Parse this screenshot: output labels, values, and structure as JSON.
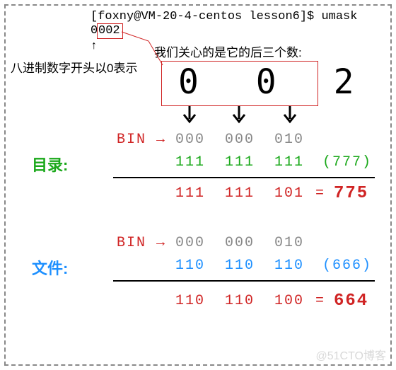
{
  "terminal": {
    "prompt": "[foxny@VM-20-4-centos lesson6]$ umask",
    "output_prefix": "0",
    "output_suffix": "002"
  },
  "notes": {
    "up_arrow": "↑",
    "octal_tip": "八进制数字开头以0表示",
    "focus_tip": "我们关心的是它的后三个数:"
  },
  "big_digits": "0 0 2",
  "bin_label": "BIN →",
  "bin1": {
    "a": "000",
    "b": "000",
    "c": "010"
  },
  "bin2": {
    "a": "000",
    "b": "000",
    "c": "010"
  },
  "dir": {
    "label": "目录:",
    "a": "111",
    "b": "111",
    "c": "111",
    "paren": "(777)",
    "r_a": "111",
    "r_b": "111",
    "r_c": "101",
    "eq": "= ",
    "res": "775"
  },
  "file": {
    "label": "文件:",
    "a": "110",
    "b": "110",
    "c": "110",
    "paren": "(666)",
    "r_a": "110",
    "r_b": "110",
    "r_c": "100",
    "eq": "= ",
    "res": "664"
  },
  "watermark": "@51CTO博客"
}
